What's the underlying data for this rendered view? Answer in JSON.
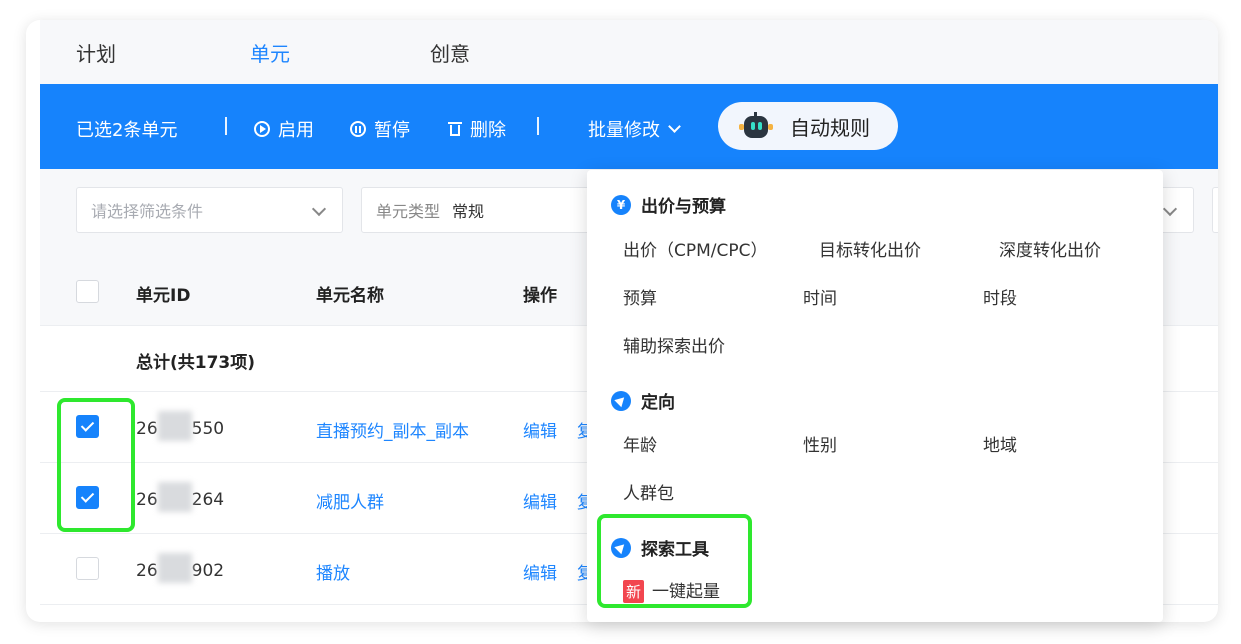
{
  "tabs": [
    {
      "label": "计划"
    },
    {
      "label": "单元",
      "active": true
    },
    {
      "label": "创意"
    }
  ],
  "actionbar": {
    "selected_text": "已选2条单元",
    "enable_label": "启用",
    "pause_label": "暂停",
    "delete_label": "删除",
    "batch_label": "批量修改",
    "auto_rule_label": "自动规则"
  },
  "filters": {
    "filter_placeholder": "请选择筛选条件",
    "unit_type_label": "单元类型",
    "unit_type_value": "常规"
  },
  "table": {
    "headers": {
      "id": "单元ID",
      "name": "单元名称",
      "op": "操作"
    },
    "total_label": "总计(共173项)",
    "rows": [
      {
        "id_prefix": "26",
        "id_suffix": "550",
        "name": "直播预约_副本_副本",
        "edit": "编辑",
        "copy": "复",
        "checked": true
      },
      {
        "id_prefix": "26",
        "id_suffix": "264",
        "name": "减肥人群",
        "edit": "编辑",
        "copy": "复",
        "checked": true
      },
      {
        "id_prefix": "26",
        "id_suffix": "902",
        "name": "播放",
        "edit": "编辑",
        "copy": "复",
        "checked": false
      }
    ]
  },
  "dropdown": {
    "sections": [
      {
        "title": "出价与预算",
        "icon": "¥",
        "options": [
          "出价（CPM/CPC）",
          "目标转化出价",
          "深度转化出价",
          "预算",
          "时间",
          "时段",
          "辅助探索出价"
        ]
      },
      {
        "title": "定向",
        "options": [
          "年龄",
          "性别",
          "地域",
          "人群包"
        ]
      },
      {
        "title": "探索工具",
        "badge": "新",
        "options": [
          "一键起量"
        ]
      }
    ]
  },
  "colors": {
    "accent": "#1683fc",
    "highlight": "#2ee82e",
    "badge": "#f2464f"
  }
}
